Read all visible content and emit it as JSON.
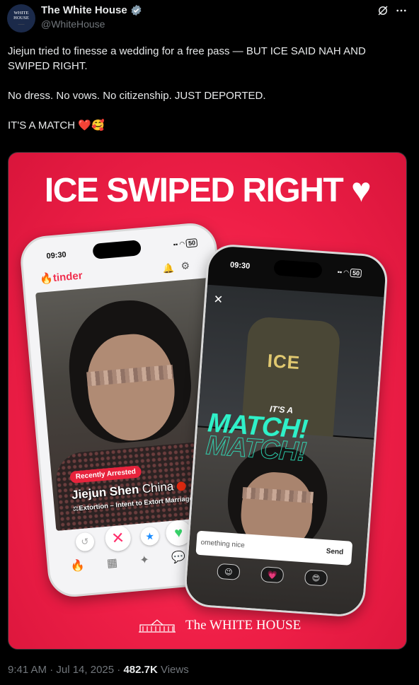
{
  "account": {
    "avatar_line1": "WHITE",
    "avatar_line2": "HOUSE",
    "name": "The White House",
    "handle": "@WhiteHouse"
  },
  "icons": [
    "verified-badge-icon",
    "grok-icon",
    "more-icon",
    "white-house-building-icon"
  ],
  "tweet": {
    "line1": "Jiejun tried to finesse a wedding for a free pass — BUT ICE SAID NAH AND SWIPED RIGHT.",
    "line2": "No dress. No vows. No citizenship. JUST DEPORTED.",
    "line3": "IT'S A MATCH ❤️🥰"
  },
  "graphic": {
    "headline": "ICE SWIPED RIGHT",
    "heart": "♥",
    "phone1": {
      "time": "09:30",
      "battery": "50",
      "app": "tinder",
      "tag": "Recently Arrested",
      "person_name": "Jiejun Shen",
      "country": "China",
      "charge": "Extortion – Intent to Extort Marriage"
    },
    "phone2": {
      "time": "09:30",
      "battery": "50",
      "vest_text": "ICE",
      "its_a": "IT'S A",
      "match": "MATCH!",
      "message_placeholder": "omething nice",
      "send": "Send"
    },
    "footer_brand": "The WHITE HOUSE"
  },
  "meta": {
    "time": "9:41 AM · Jul 14, 2025 · ",
    "views_count": "482.7K",
    "views_label": " Views"
  },
  "colors": {
    "accent": "#ef1f47",
    "teal": "#2ff0c8",
    "verified": "#829aab"
  }
}
